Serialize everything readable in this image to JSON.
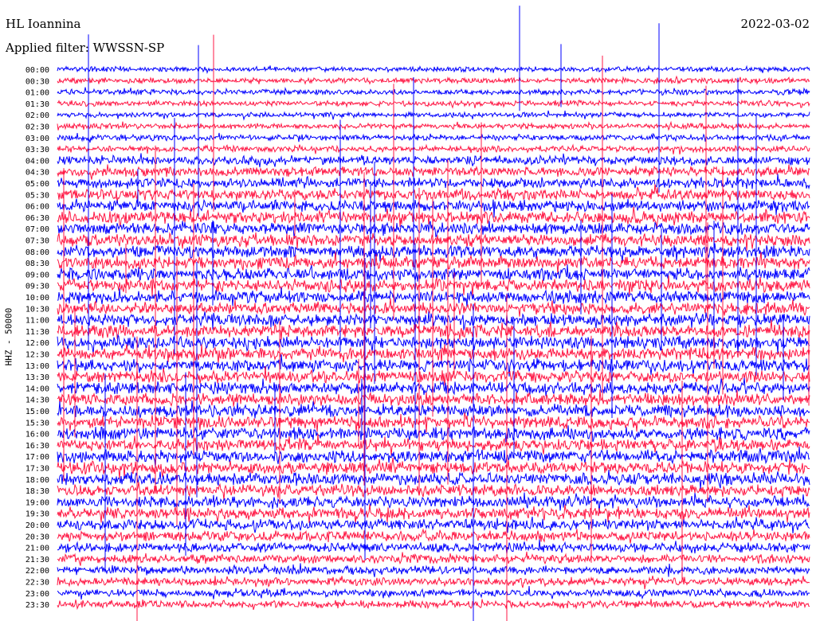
{
  "header": {
    "station": "HL Ioannina",
    "date": "2022-03-02",
    "filter": "Applied filter: WWSSN-SP"
  },
  "chart_data": {
    "type": "line",
    "subtype": "helicorder",
    "ylabel": "HHZ - 50000",
    "colors": [
      "#0000ff",
      "#ff1744"
    ],
    "trace_labels": [
      "00:00",
      "00:30",
      "01:00",
      "01:30",
      "02:00",
      "02:30",
      "03:00",
      "03:30",
      "04:00",
      "04:30",
      "05:00",
      "05:30",
      "06:00",
      "06:30",
      "07:00",
      "07:30",
      "08:00",
      "08:30",
      "09:00",
      "09:30",
      "10:00",
      "10:30",
      "11:00",
      "11:30",
      "12:00",
      "12:30",
      "13:00",
      "13:30",
      "14:00",
      "14:30",
      "15:00",
      "15:30",
      "16:00",
      "16:30",
      "17:00",
      "17:30",
      "18:00",
      "18:30",
      "19:00",
      "19:30",
      "20:00",
      "20:30",
      "21:00",
      "21:30",
      "22:00",
      "22:30",
      "23:00",
      "23:30"
    ],
    "activity_level": [
      0.25,
      0.3,
      0.3,
      0.3,
      0.25,
      0.3,
      0.35,
      0.35,
      0.55,
      0.6,
      0.65,
      0.7,
      0.75,
      0.8,
      0.8,
      0.8,
      0.8,
      0.8,
      0.8,
      0.8,
      0.8,
      0.8,
      0.8,
      0.8,
      0.8,
      0.8,
      0.8,
      0.8,
      0.8,
      0.8,
      0.8,
      0.8,
      0.8,
      0.8,
      0.8,
      0.8,
      0.8,
      0.8,
      0.75,
      0.75,
      0.7,
      0.65,
      0.6,
      0.55,
      0.5,
      0.5,
      0.45,
      0.45
    ]
  }
}
